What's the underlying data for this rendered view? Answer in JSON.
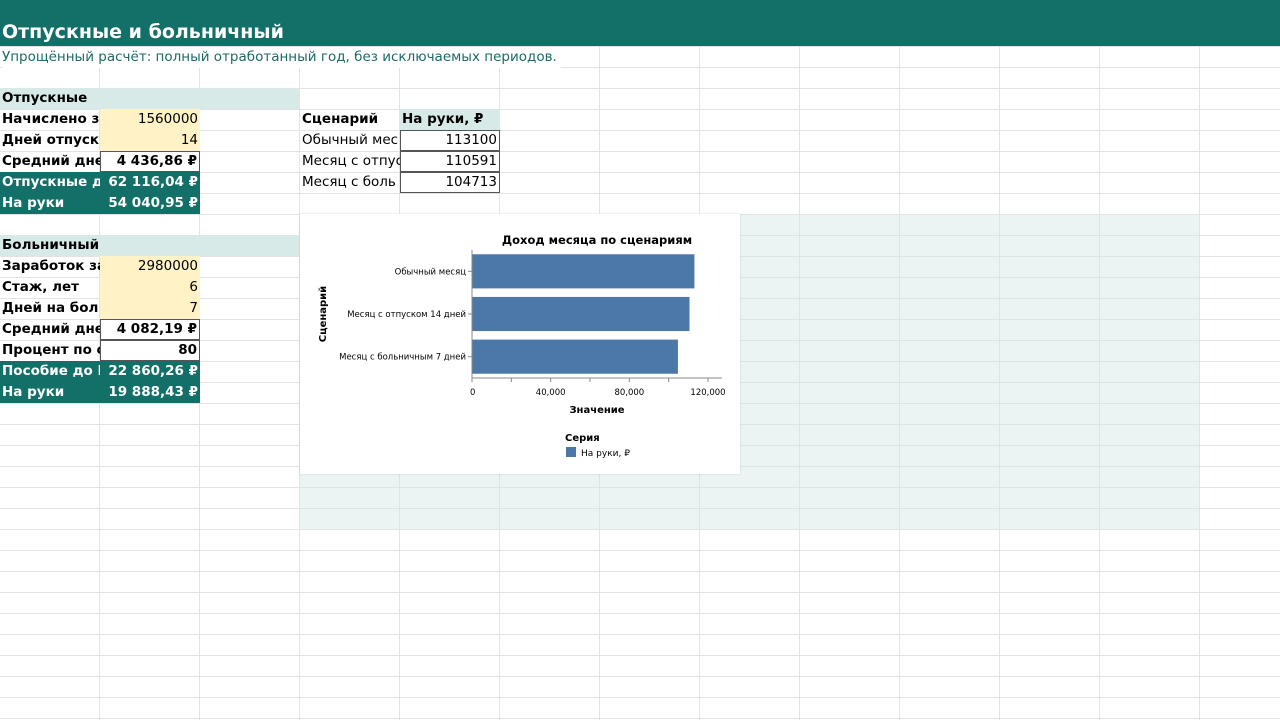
{
  "header": {
    "title": "Отпускные и больничный",
    "subtitle": "Упрощённый расчёт: полный отработанный год, без исключаемых периодов."
  },
  "vacation": {
    "section_title": "Отпускные",
    "rows": [
      {
        "label": "Начислено з",
        "value": "1560000"
      },
      {
        "label": "Дней отпуск",
        "value": "14"
      },
      {
        "label": "Средний дне",
        "value": "4 436,86 ₽"
      },
      {
        "label": "Отпускные д",
        "value": "62 116,04 ₽"
      },
      {
        "label": "На руки",
        "value": "54 040,95 ₽"
      }
    ]
  },
  "sick": {
    "section_title": "Больничный",
    "rows": [
      {
        "label": "Заработок за",
        "value": "2980000"
      },
      {
        "label": "Стаж, лет",
        "value": "6"
      },
      {
        "label": "Дней на бол",
        "value": "7"
      },
      {
        "label": "Средний дне",
        "value": "4 082,19 ₽"
      },
      {
        "label": "Процент по с",
        "value": "80"
      },
      {
        "label": "Пособие до Н",
        "value": "22 860,26 ₽"
      },
      {
        "label": "На руки",
        "value": "19 888,43 ₽"
      }
    ]
  },
  "scenarios": {
    "col1": "Сценарий",
    "col2": "На руки, ₽",
    "rows": [
      {
        "name": "Обычный мес",
        "value": "113100"
      },
      {
        "name": "Месяц с отпус",
        "value": "110591"
      },
      {
        "name": "Месяц с боль",
        "value": "104713"
      }
    ]
  },
  "colors": {
    "accent": "#127068",
    "bar": "#4c78a8",
    "input": "#fff2c6",
    "band": "#d8eae7"
  },
  "chart_data": {
    "type": "bar",
    "orientation": "horizontal",
    "title": "Доход месяца по сценариям",
    "xlabel": "Значение",
    "ylabel": "Сценарий",
    "categories": [
      "Обычный месяц",
      "Месяц с отпуском 14 дней",
      "Месяц с больничным 7 дней"
    ],
    "series": [
      {
        "name": "На руки, ₽",
        "values": [
          113100,
          110591,
          104713
        ]
      }
    ],
    "xlim": [
      0,
      120000
    ],
    "xticks": [
      "0",
      "40,000",
      "80,000",
      "120,000"
    ],
    "legend_title": "Серия",
    "legend_position": "bottom-left",
    "grid": false
  }
}
